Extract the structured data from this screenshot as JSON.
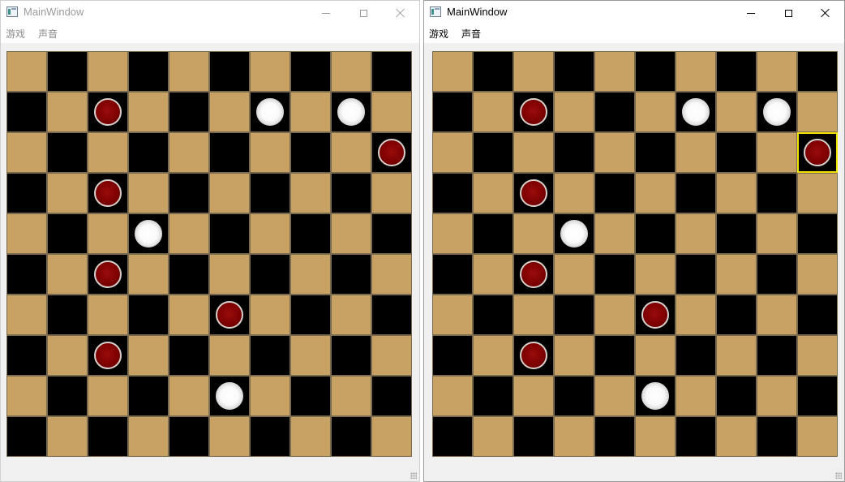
{
  "colors": {
    "light_square": "#c8a165",
    "dark_square": "#000000",
    "red_piece": "#7d0000",
    "white_piece": "#ffffff",
    "selection": "#f2e200"
  },
  "windows": [
    {
      "id": "left",
      "state": "inactive",
      "title": "MainWindow",
      "menu": [
        "游戏",
        "声音"
      ],
      "board": {
        "size": 10,
        "top_left_square": "light",
        "pieces": [
          {
            "row": 1,
            "col": 2,
            "color": "red"
          },
          {
            "row": 1,
            "col": 6,
            "color": "white"
          },
          {
            "row": 1,
            "col": 8,
            "color": "white"
          },
          {
            "row": 2,
            "col": 9,
            "color": "red"
          },
          {
            "row": 3,
            "col": 2,
            "color": "red"
          },
          {
            "row": 4,
            "col": 3,
            "color": "white"
          },
          {
            "row": 5,
            "col": 2,
            "color": "red"
          },
          {
            "row": 6,
            "col": 5,
            "color": "red"
          },
          {
            "row": 7,
            "col": 2,
            "color": "red"
          },
          {
            "row": 8,
            "col": 5,
            "color": "white"
          }
        ],
        "selected": null
      }
    },
    {
      "id": "right",
      "state": "active",
      "title": "MainWindow",
      "menu": [
        "游戏",
        "声音"
      ],
      "board": {
        "size": 10,
        "top_left_square": "light",
        "pieces": [
          {
            "row": 1,
            "col": 2,
            "color": "red"
          },
          {
            "row": 1,
            "col": 6,
            "color": "white"
          },
          {
            "row": 1,
            "col": 8,
            "color": "white"
          },
          {
            "row": 2,
            "col": 9,
            "color": "red"
          },
          {
            "row": 3,
            "col": 2,
            "color": "red"
          },
          {
            "row": 4,
            "col": 3,
            "color": "white"
          },
          {
            "row": 5,
            "col": 2,
            "color": "red"
          },
          {
            "row": 6,
            "col": 5,
            "color": "red"
          },
          {
            "row": 7,
            "col": 2,
            "color": "red"
          },
          {
            "row": 8,
            "col": 5,
            "color": "white"
          }
        ],
        "selected": {
          "row": 2,
          "col": 9
        }
      }
    }
  ]
}
